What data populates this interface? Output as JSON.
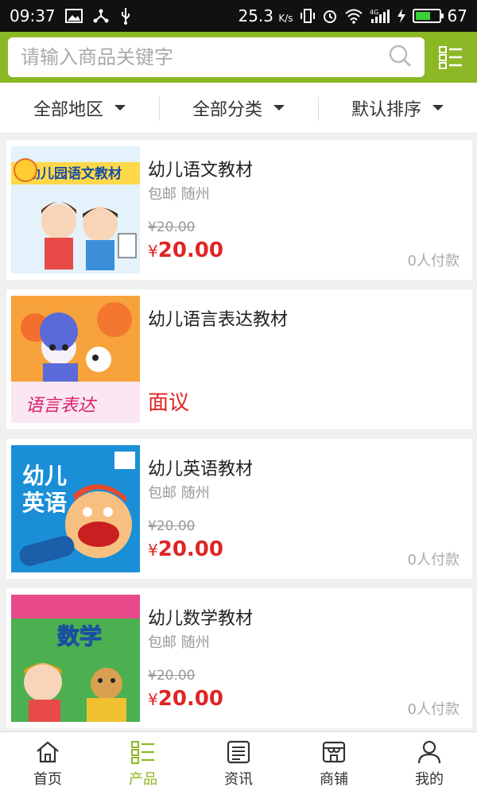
{
  "status_bar": {
    "time": "09:37",
    "speed": "25.3",
    "speed_unit": "K/s",
    "network": "4G",
    "battery": "67",
    "battery_level": 0.67
  },
  "search": {
    "placeholder": "请输入商品关键字"
  },
  "filters": [
    {
      "label": "全部地区"
    },
    {
      "label": "全部分类"
    },
    {
      "label": "默认排序"
    }
  ],
  "products": [
    {
      "title": "幼儿语文教材",
      "meta": "包邮 随州",
      "old_price": "¥20.00",
      "price_symbol": "¥",
      "price": "20.00",
      "paid": "0人付款",
      "thumb_text": "幼儿园语文教材",
      "thumb_color": "#e8f4fb"
    },
    {
      "title": "幼儿语言表达教材",
      "negotiate": "面议",
      "thumb_text": "语言表达",
      "thumb_color": "#f7a23a"
    },
    {
      "title": "幼儿英语教材",
      "meta": "包邮 随州",
      "old_price": "¥20.00",
      "price_symbol": "¥",
      "price": "20.00",
      "paid": "0人付款",
      "thumb_text": "幼儿英语",
      "thumb_color": "#1a8fd8"
    },
    {
      "title": "幼儿数学教材",
      "meta": "包邮 随州",
      "old_price": "¥20.00",
      "price_symbol": "¥",
      "price": "20.00",
      "paid": "0人付款",
      "thumb_text": "数学",
      "thumb_color": "#4caf50"
    }
  ],
  "nav": [
    {
      "label": "首页",
      "icon": "home-icon"
    },
    {
      "label": "产品",
      "icon": "list-icon"
    },
    {
      "label": "资讯",
      "icon": "news-icon"
    },
    {
      "label": "商铺",
      "icon": "store-icon"
    },
    {
      "label": "我的",
      "icon": "user-icon"
    }
  ],
  "colors": {
    "accent": "#8cb826",
    "price": "#e02424"
  }
}
